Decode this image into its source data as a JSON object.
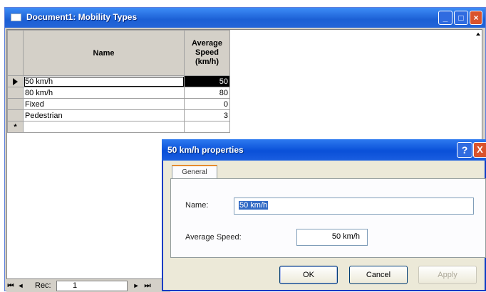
{
  "window": {
    "title": "Document1: Mobility Types",
    "minimize_icon": "minimize-icon",
    "maximize_icon": "maximize-icon",
    "close_icon": "close-icon"
  },
  "grid": {
    "columns": [
      "Name",
      "Average Speed (km/h)"
    ],
    "rows": [
      {
        "name": "50 km/h",
        "speed": "50",
        "selected": true
      },
      {
        "name": "80 km/h",
        "speed": "80"
      },
      {
        "name": "Fixed",
        "speed": "0"
      },
      {
        "name": "Pedestrian",
        "speed": "3"
      }
    ],
    "new_row_marker": "*"
  },
  "navigator": {
    "first": "⏮",
    "prev": "◂",
    "label": "Rec:",
    "current": "1",
    "next": "▸",
    "last": "⏭"
  },
  "dialog": {
    "title": "50 km/h properties",
    "help": "?",
    "close": "X",
    "tab": "General",
    "name_label": "Name:",
    "name_value": "50 km/h",
    "speed_label": "Average Speed:",
    "speed_value": "50 km/h",
    "ok": "OK",
    "cancel": "Cancel",
    "apply": "Apply"
  }
}
